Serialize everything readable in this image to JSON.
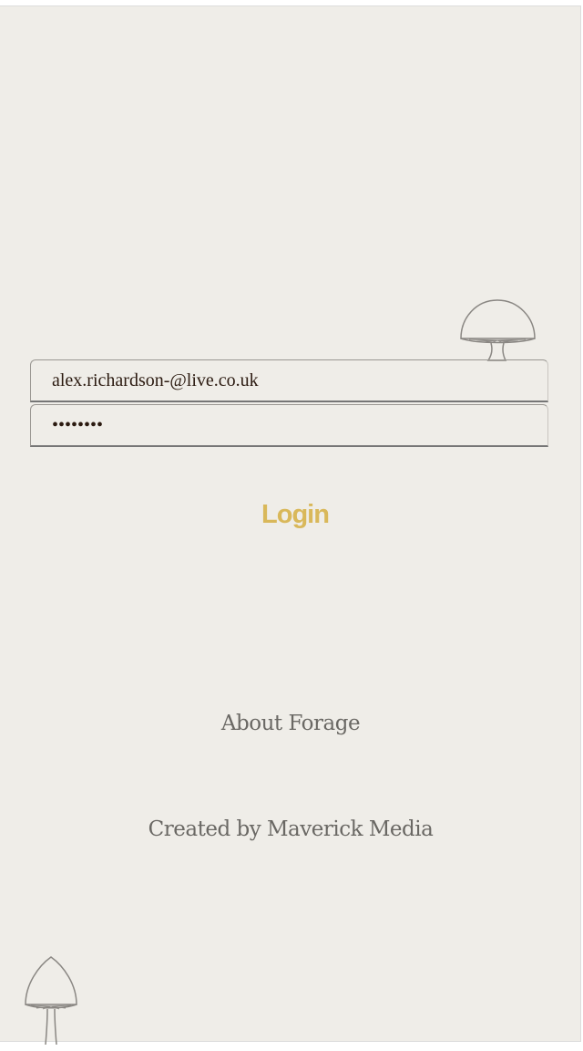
{
  "login_form": {
    "email_value": "alex.richardson-@live.co.uk",
    "password_value": "••••••••",
    "login_label": "Login"
  },
  "footer": {
    "about_label": "About Forage",
    "credit_text": "Created by Maverick Media"
  },
  "decorations": {
    "top_icon": "mushroom-icon",
    "bottom_icon": "mushroom-icon"
  },
  "colors": {
    "background": "#efede8",
    "accent": "#d9b85a",
    "text": "#6a6864"
  }
}
